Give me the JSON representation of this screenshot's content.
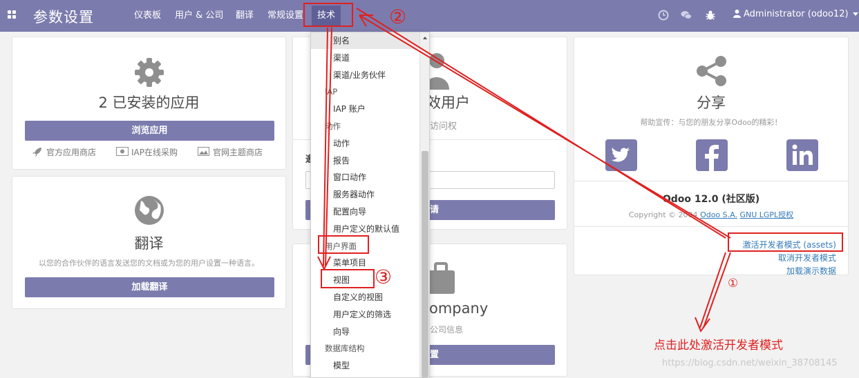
{
  "navbar": {
    "brand": "参数设置",
    "menu": [
      "仪表板",
      "用户 & 公司",
      "翻译",
      "常规设置",
      "技术"
    ],
    "user": "Administrator (odoo12)",
    "icons": [
      "apps-icon",
      "clock-icon",
      "chat-icon",
      "bug-icon",
      "user-icon"
    ]
  },
  "apps_card": {
    "title": "2 已安装的应用",
    "button": "浏览应用",
    "links": [
      "官方应用商店",
      "IAP在线采购",
      "官网主题商店"
    ]
  },
  "translation_card": {
    "title": "翻译",
    "subtitle": "以您的合作伙伴的语言发送您的文档或为您的用户设置一种语言。",
    "button": "加载翻译"
  },
  "users_card": {
    "title_fragment": "效用户",
    "sub_fragment": "访问权",
    "section_fragment": "邀",
    "button_fragment": "请"
  },
  "company_card": {
    "title_fragment": "ompany",
    "sub_fragment": "公司信息",
    "button_fragment": "置"
  },
  "share_card": {
    "title": "分享",
    "subtitle": "帮助宣传：与您的朋友分享Odoo的精彩！",
    "version": "Odoo 12.0 (社区版)",
    "copyright_prefix": "Copyright © 2004",
    "company_link": "Odoo S.A.",
    "license_link": "GNU LGPL授权",
    "dev_links": [
      "激活开发者模式 (assets)",
      "取消开发者模式",
      "加载演示数据"
    ]
  },
  "dropdown": {
    "items": [
      {
        "label": "别名",
        "kind": "child",
        "highlighted": true
      },
      {
        "label": "渠道",
        "kind": "child"
      },
      {
        "label": "渠道/业务伙伴",
        "kind": "child"
      },
      {
        "label": "IAP",
        "kind": "header"
      },
      {
        "label": "IAP 账户",
        "kind": "child"
      },
      {
        "label": "动作",
        "kind": "header"
      },
      {
        "label": "动作",
        "kind": "child"
      },
      {
        "label": "报告",
        "kind": "child"
      },
      {
        "label": "窗口动作",
        "kind": "child"
      },
      {
        "label": "服务器动作",
        "kind": "child"
      },
      {
        "label": "配置向导",
        "kind": "child"
      },
      {
        "label": "用户定义的默认值",
        "kind": "child"
      },
      {
        "label": "用户界面",
        "kind": "header"
      },
      {
        "label": "菜单项目",
        "kind": "child"
      },
      {
        "label": "视图",
        "kind": "child"
      },
      {
        "label": "自定义的视图",
        "kind": "child"
      },
      {
        "label": "用户定义的筛选",
        "kind": "child"
      },
      {
        "label": "向导",
        "kind": "child"
      },
      {
        "label": "数据库结构",
        "kind": "header"
      },
      {
        "label": "模型",
        "kind": "child"
      }
    ]
  },
  "annotations": {
    "step1": "①",
    "step2": "②",
    "step3": "③",
    "note": "点击此处激活开发者模式"
  },
  "watermark": "https://blog.csdn.net/weixin_38708145",
  "colors": {
    "primary": "#7c7bad",
    "annotation": "#e02020",
    "link": "#337ab7"
  }
}
